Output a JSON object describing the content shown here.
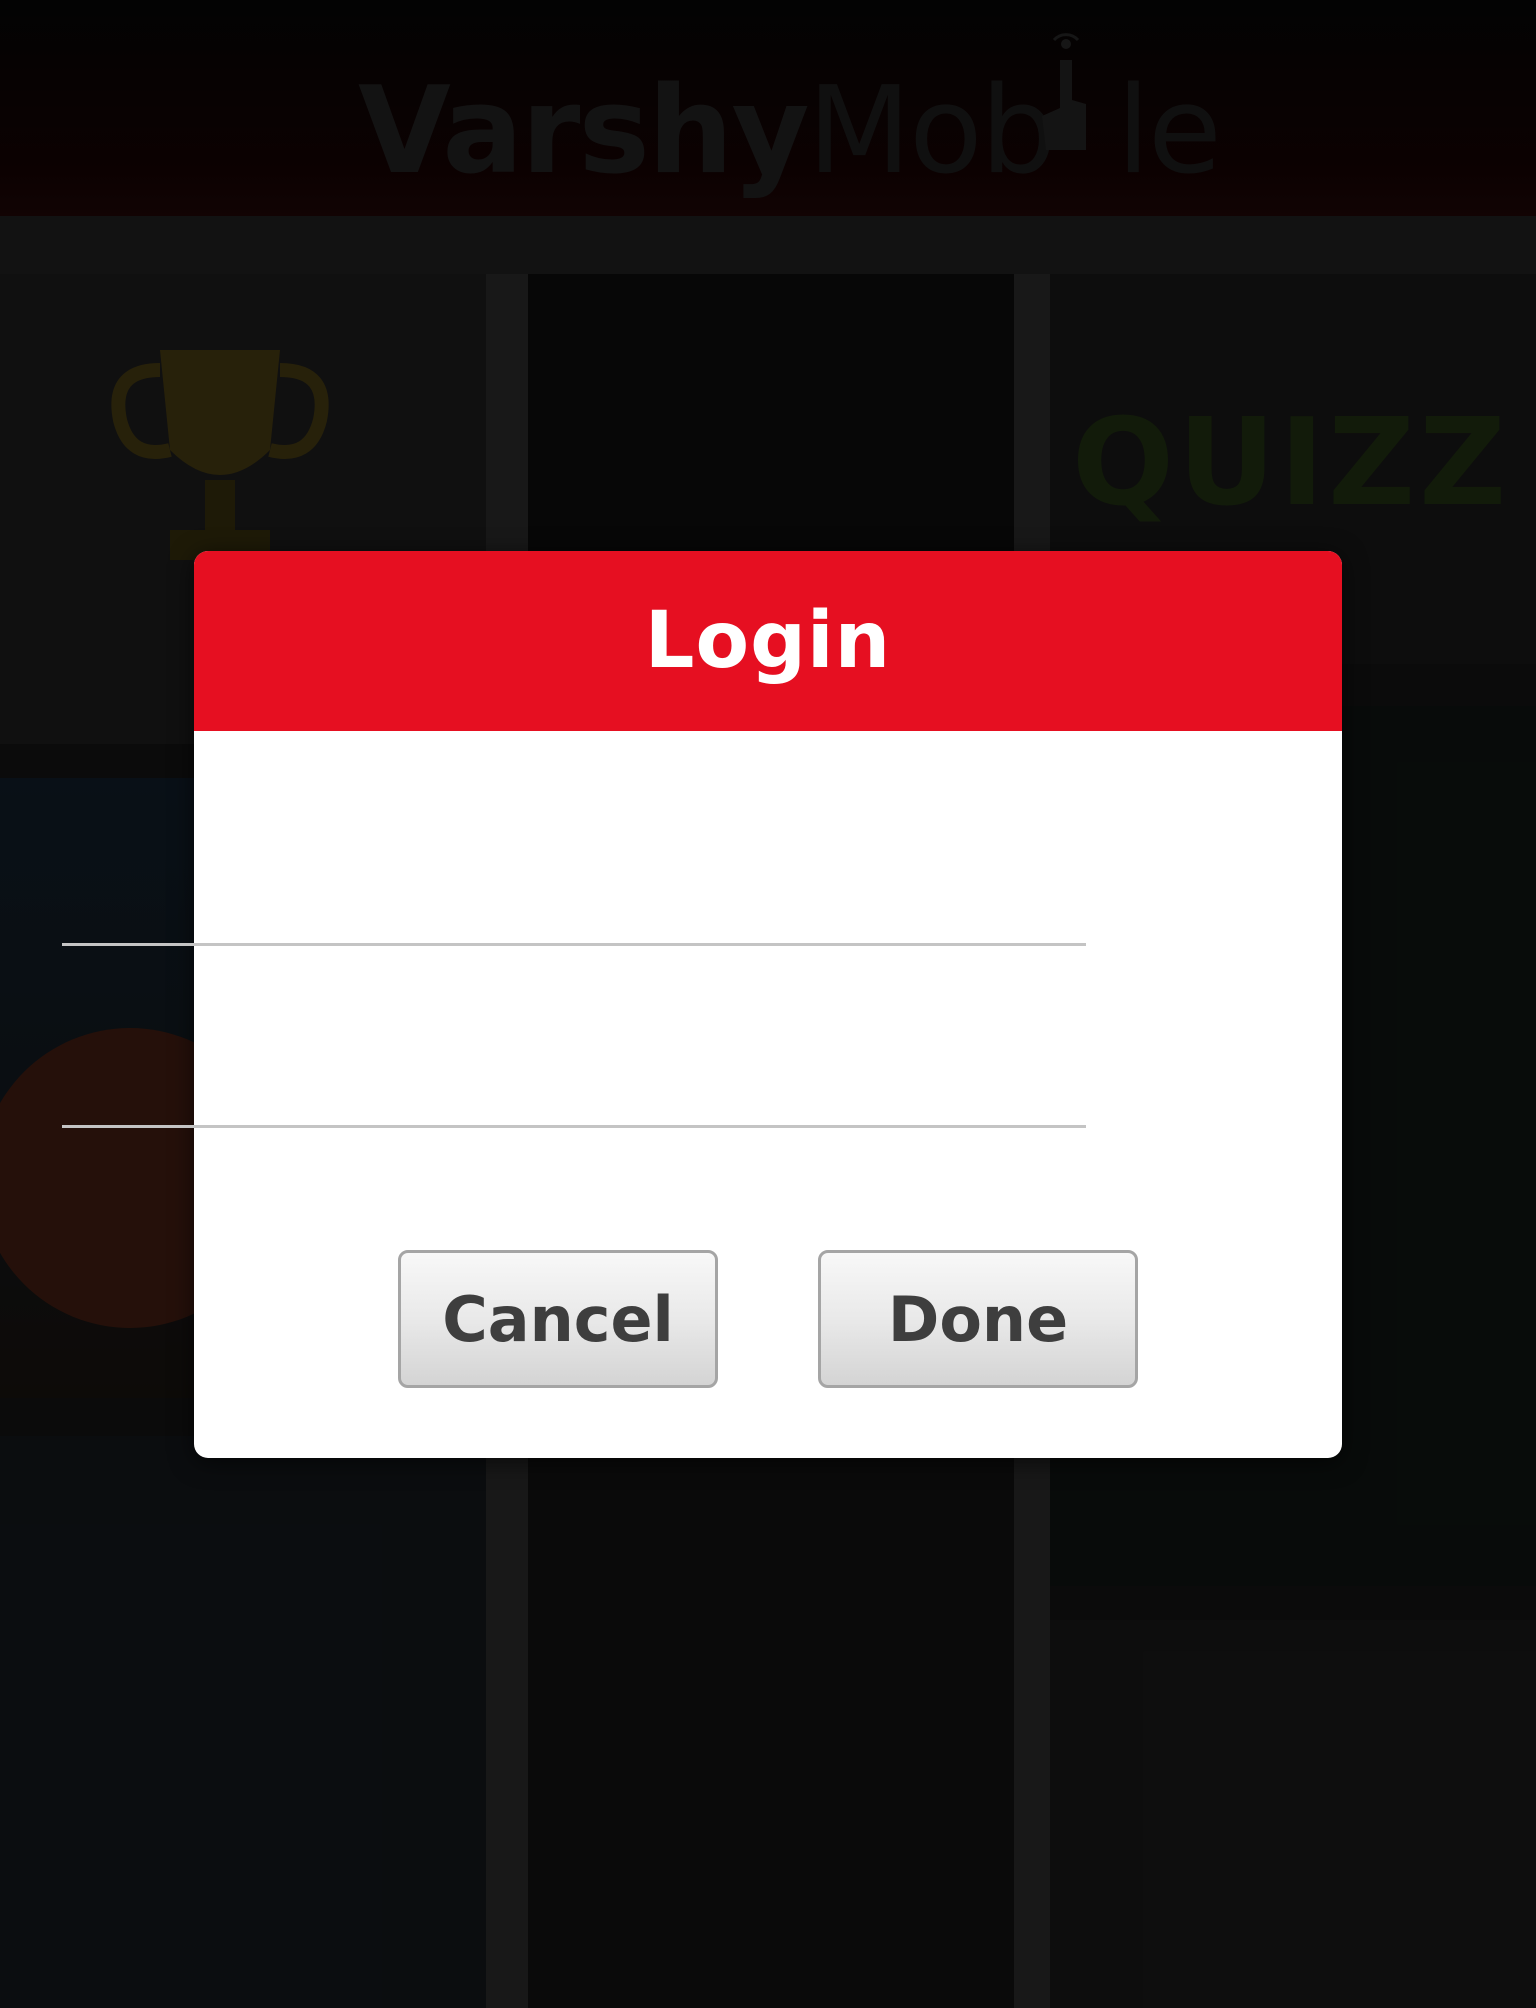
{
  "app": {
    "logo_bold": "Varshy",
    "logo_light": "Mob",
    "logo_tail": "le"
  },
  "tiles": {
    "quiz_label": "QUIZZ"
  },
  "dialog": {
    "title": "Login",
    "username_value": "",
    "password_value": "",
    "cancel_label": "Cancel",
    "done_label": "Done"
  },
  "colors": {
    "header_red": "#e60f21",
    "button_text": "#3e3e3e",
    "field_line": "#c4c4c4"
  }
}
